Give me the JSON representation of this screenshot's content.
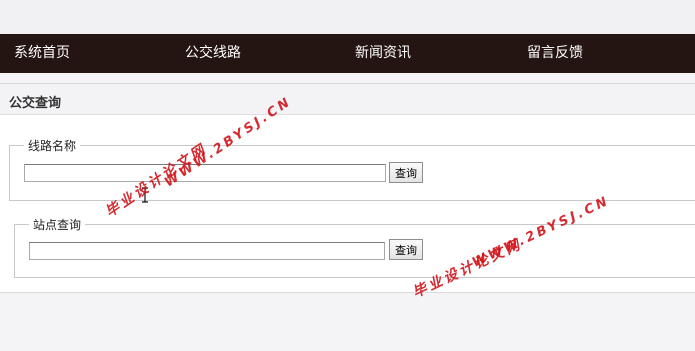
{
  "nav": {
    "items": [
      "系统首页",
      "公交线路",
      "新闻资讯",
      "留言反馈"
    ]
  },
  "panel": {
    "title": "公交查询"
  },
  "route_search": {
    "legend": "线路名称",
    "input_value": "",
    "button_label": "查询"
  },
  "stop_search": {
    "legend": "站点查询",
    "input_value": "",
    "button_label": "查询"
  },
  "watermarks": {
    "url": "WWW.2BYSJ.CN",
    "site_name": "毕业设计论文网"
  },
  "colors": {
    "nav_bg": "#241512",
    "watermark": "#d0141a"
  }
}
